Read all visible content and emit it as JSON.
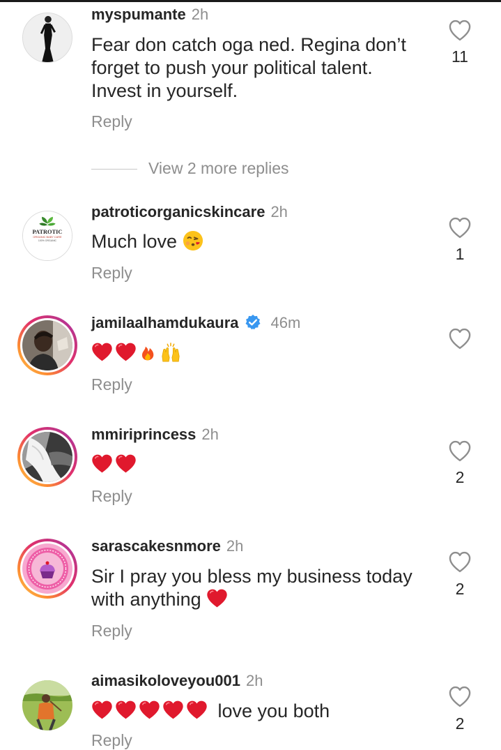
{
  "colors": {
    "text": "#262626",
    "muted": "#8e8e8e",
    "heart_red": "#e0192d",
    "verified_blue": "#3897f0"
  },
  "reply_label": "Reply",
  "view_more_replies": "View 2 more replies",
  "comments": [
    {
      "username": "myspumante",
      "time": "2h",
      "text": "Fear don catch oga ned. Regina don’t forget to push your political talent. Invest in yourself.",
      "likes": "11",
      "avatar_icon": "woman-black-dress-avatar",
      "story_ring": false
    },
    {
      "username": "patroticorganicskincare",
      "time": "2h",
      "text": "Much love",
      "emoji": [
        "face-blowing-kiss-emoji"
      ],
      "likes": "1",
      "avatar_icon": "patrotic-logo-avatar",
      "avatar_logo_text": "PATROTIC",
      "avatar_logo_sub": "ORGANIC BABY CARE",
      "avatar_logo_sub2": "100% ORGANIC",
      "story_ring": false
    },
    {
      "username": "jamilaalhamdukaura",
      "verified": true,
      "time": "46m",
      "text": "",
      "emoji": [
        "red-heart-emoji",
        "red-heart-emoji",
        "fire-emoji",
        "raising-hands-emoji"
      ],
      "likes": "",
      "avatar_icon": "man-photo-avatar",
      "story_ring": true
    },
    {
      "username": "mmiriprincess",
      "time": "2h",
      "text": "",
      "emoji": [
        "red-heart-emoji",
        "red-heart-emoji"
      ],
      "likes": "2",
      "avatar_icon": "bw-photo-avatar",
      "story_ring": true
    },
    {
      "username": "sarascakesnmore",
      "time": "2h",
      "text": "Sir I pray you bless my business today with anything",
      "emoji": [
        "red-heart-emoji"
      ],
      "likes": "2",
      "avatar_icon": "cake-logo-avatar",
      "story_ring": true
    },
    {
      "username": "aimasikoloveyou001",
      "time": "2h",
      "text": "love you both",
      "emoji": [
        "red-heart-emoji",
        "red-heart-emoji",
        "red-heart-emoji",
        "red-heart-emoji",
        "red-heart-emoji"
      ],
      "likes": "2",
      "avatar_icon": "outdoor-photo-avatar",
      "story_ring": false
    }
  ]
}
